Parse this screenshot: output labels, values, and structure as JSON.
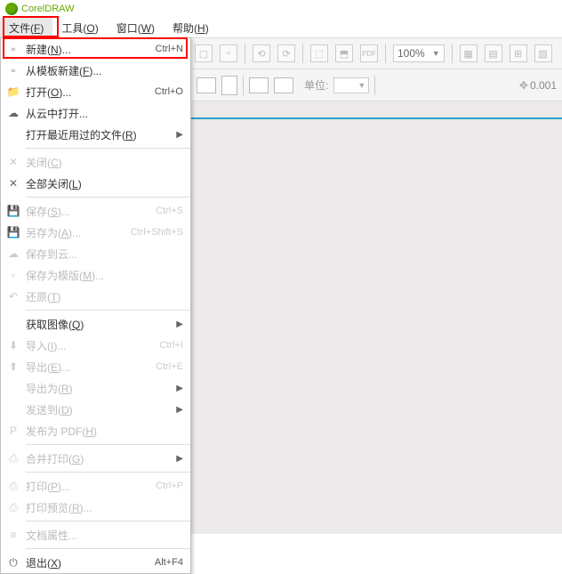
{
  "app": {
    "title": "CorelDRAW"
  },
  "menubar": [
    {
      "label": "文件",
      "hk": "F",
      "active": true
    },
    {
      "label": "工具",
      "hk": "O"
    },
    {
      "label": "窗口",
      "hk": "W"
    },
    {
      "label": "帮助",
      "hk": "H"
    }
  ],
  "dropdown": {
    "groups": [
      [
        {
          "icon": "new-icon",
          "label": "新建",
          "hk": "N",
          "suffix": "...",
          "shortcut": "Ctrl+N",
          "enabled": true
        },
        {
          "icon": "template-icon",
          "label": "从模板新建",
          "hk": "F",
          "suffix": "...",
          "enabled": true
        },
        {
          "icon": "open-icon",
          "label": "打开",
          "hk": "O",
          "suffix": "...",
          "shortcut": "Ctrl+O",
          "enabled": true
        },
        {
          "icon": "cloud-open-icon",
          "label": "从云中打开...",
          "enabled": true
        },
        {
          "icon": "recent-icon",
          "label": "打开最近用过的文件",
          "hk": "R",
          "arrow": true,
          "enabled": true
        }
      ],
      [
        {
          "icon": "close-icon",
          "label": "关闭",
          "hk": "C",
          "enabled": false
        },
        {
          "icon": "close-all-icon",
          "label": "全部关闭",
          "hk": "L",
          "enabled": true
        }
      ],
      [
        {
          "icon": "save-icon",
          "label": "保存",
          "hk": "S",
          "suffix": "...",
          "shortcut": "Ctrl+S",
          "enabled": false
        },
        {
          "icon": "saveas-icon",
          "label": "另存为",
          "hk": "A",
          "suffix": "...",
          "shortcut": "Ctrl+Shift+S",
          "enabled": false
        },
        {
          "icon": "savecloud-icon",
          "label": "保存到云...",
          "enabled": false
        },
        {
          "icon": "savetpl-icon",
          "label": "保存为模版",
          "hk": "M",
          "suffix": "...",
          "enabled": false
        },
        {
          "icon": "revert-icon",
          "label": "还原",
          "hk": "T",
          "enabled": false
        }
      ],
      [
        {
          "icon": "acquire-icon",
          "label": "获取图像",
          "hk": "Q",
          "arrow": true,
          "enabled": true
        },
        {
          "icon": "import-icon",
          "label": "导入",
          "hk": "I",
          "suffix": "...",
          "shortcut": "Ctrl+I",
          "enabled": false
        },
        {
          "icon": "export-icon",
          "label": "导出",
          "hk": "E",
          "suffix": "...",
          "shortcut": "Ctrl+E",
          "enabled": false
        },
        {
          "icon": "exportfor-icon",
          "label": "导出为",
          "hk": "R",
          "arrow": true,
          "enabled": false
        },
        {
          "icon": "sendto-icon",
          "label": "发送到",
          "hk": "D",
          "arrow": true,
          "enabled": false
        },
        {
          "icon": "pdf-icon",
          "label": "发布为 PDF",
          "hk": "H",
          "enabled": false
        }
      ],
      [
        {
          "icon": "merge-icon",
          "label": "合并打印",
          "hk": "G",
          "arrow": true,
          "enabled": false
        }
      ],
      [
        {
          "icon": "print-icon",
          "label": "打印",
          "hk": "P",
          "suffix": "...",
          "shortcut": "Ctrl+P",
          "enabled": false
        },
        {
          "icon": "preview-icon",
          "label": "打印预览",
          "hk": "R",
          "suffix": "...",
          "enabled": false
        }
      ],
      [
        {
          "icon": "docprops-icon",
          "label": "文档属性...",
          "enabled": false
        }
      ],
      [
        {
          "icon": "exit-icon",
          "label": "退出",
          "hk": "X",
          "shortcut": "Alt+F4",
          "enabled": true
        }
      ]
    ]
  },
  "toolbar1": {
    "zoom": "100%",
    "pdf_label": "PDF"
  },
  "toolbar2": {
    "units_label": "单位:",
    "nudge_value": "0.001"
  }
}
